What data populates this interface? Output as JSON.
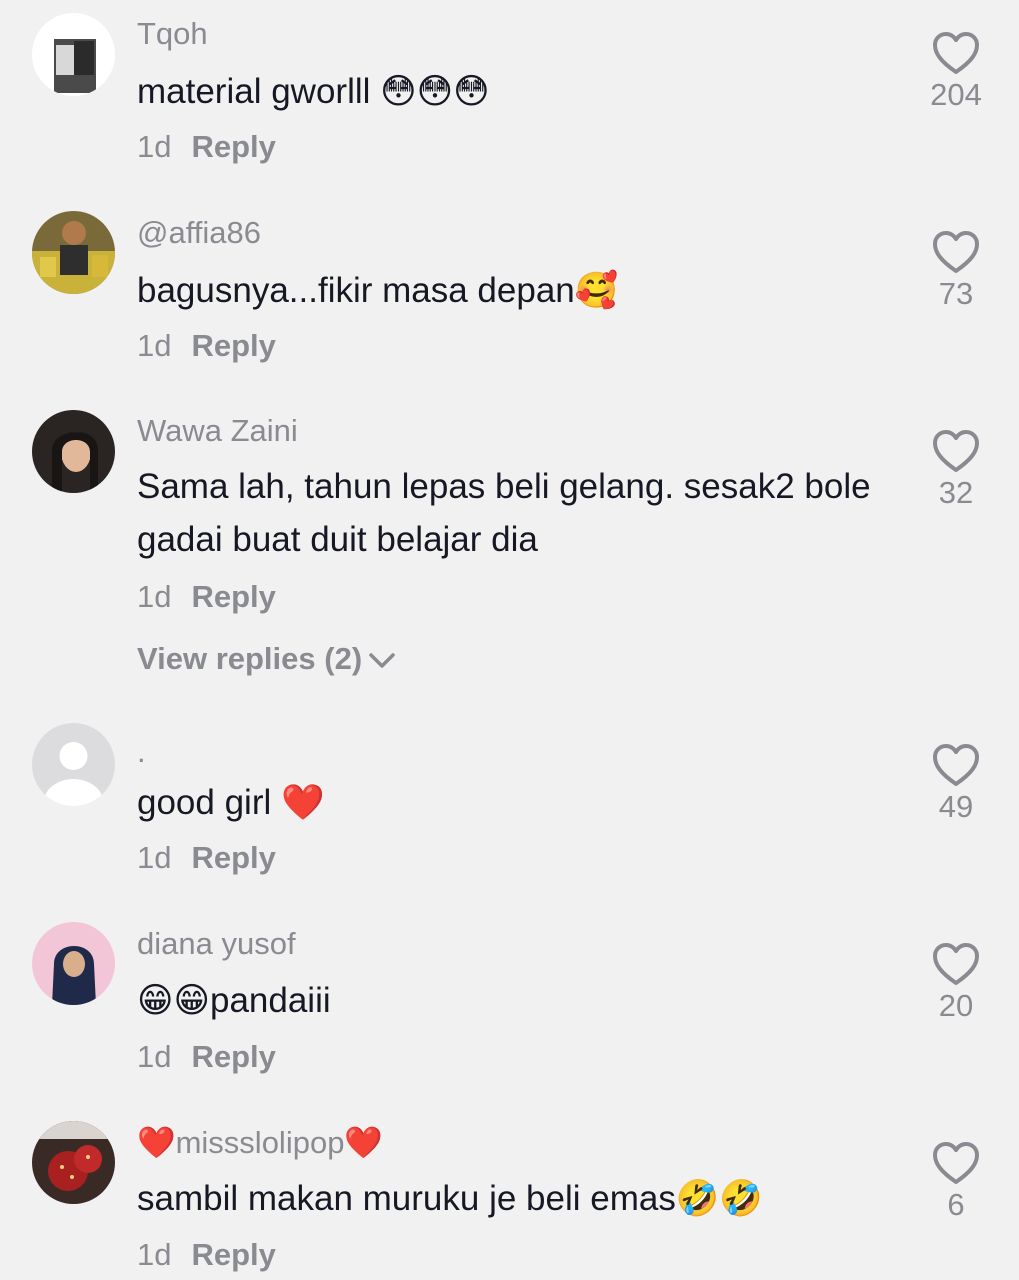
{
  "comments": [
    {
      "username": "Tqoh",
      "text": "material gworlll 😳😳😳",
      "time": "1d",
      "reply": "Reply",
      "likes": "204",
      "avatar": "photo-avatar"
    },
    {
      "username": "@affia86",
      "text": "bagusnya...fikir masa depan🥰",
      "time": "1d",
      "reply": "Reply",
      "likes": "73",
      "avatar": "photo-avatar"
    },
    {
      "username": "Wawa Zaini",
      "text": "Sama lah, tahun lepas beli gelang. sesak2 bole gadai buat duit belajar dia",
      "time": "1d",
      "reply": "Reply",
      "likes": "32",
      "avatar": "photo-avatar",
      "view_replies": "View replies (2)"
    },
    {
      "username": ".",
      "text": "good girl ❤️",
      "time": "1d",
      "reply": "Reply",
      "likes": "49",
      "avatar": "default-avatar"
    },
    {
      "username": "diana yusof",
      "text": "😁😁pandaiii",
      "time": "1d",
      "reply": "Reply",
      "likes": "20",
      "avatar": "photo-avatar"
    },
    {
      "username": "❤️missslolipop❤️",
      "text": "sambil makan muruku je beli emas🤣🤣",
      "time": "1d",
      "reply": "Reply",
      "likes": "6",
      "avatar": "photo-avatar"
    }
  ],
  "colors": {
    "background": "#f1f1f2",
    "primary_text": "#161823",
    "secondary_text": "#8a8b91"
  }
}
